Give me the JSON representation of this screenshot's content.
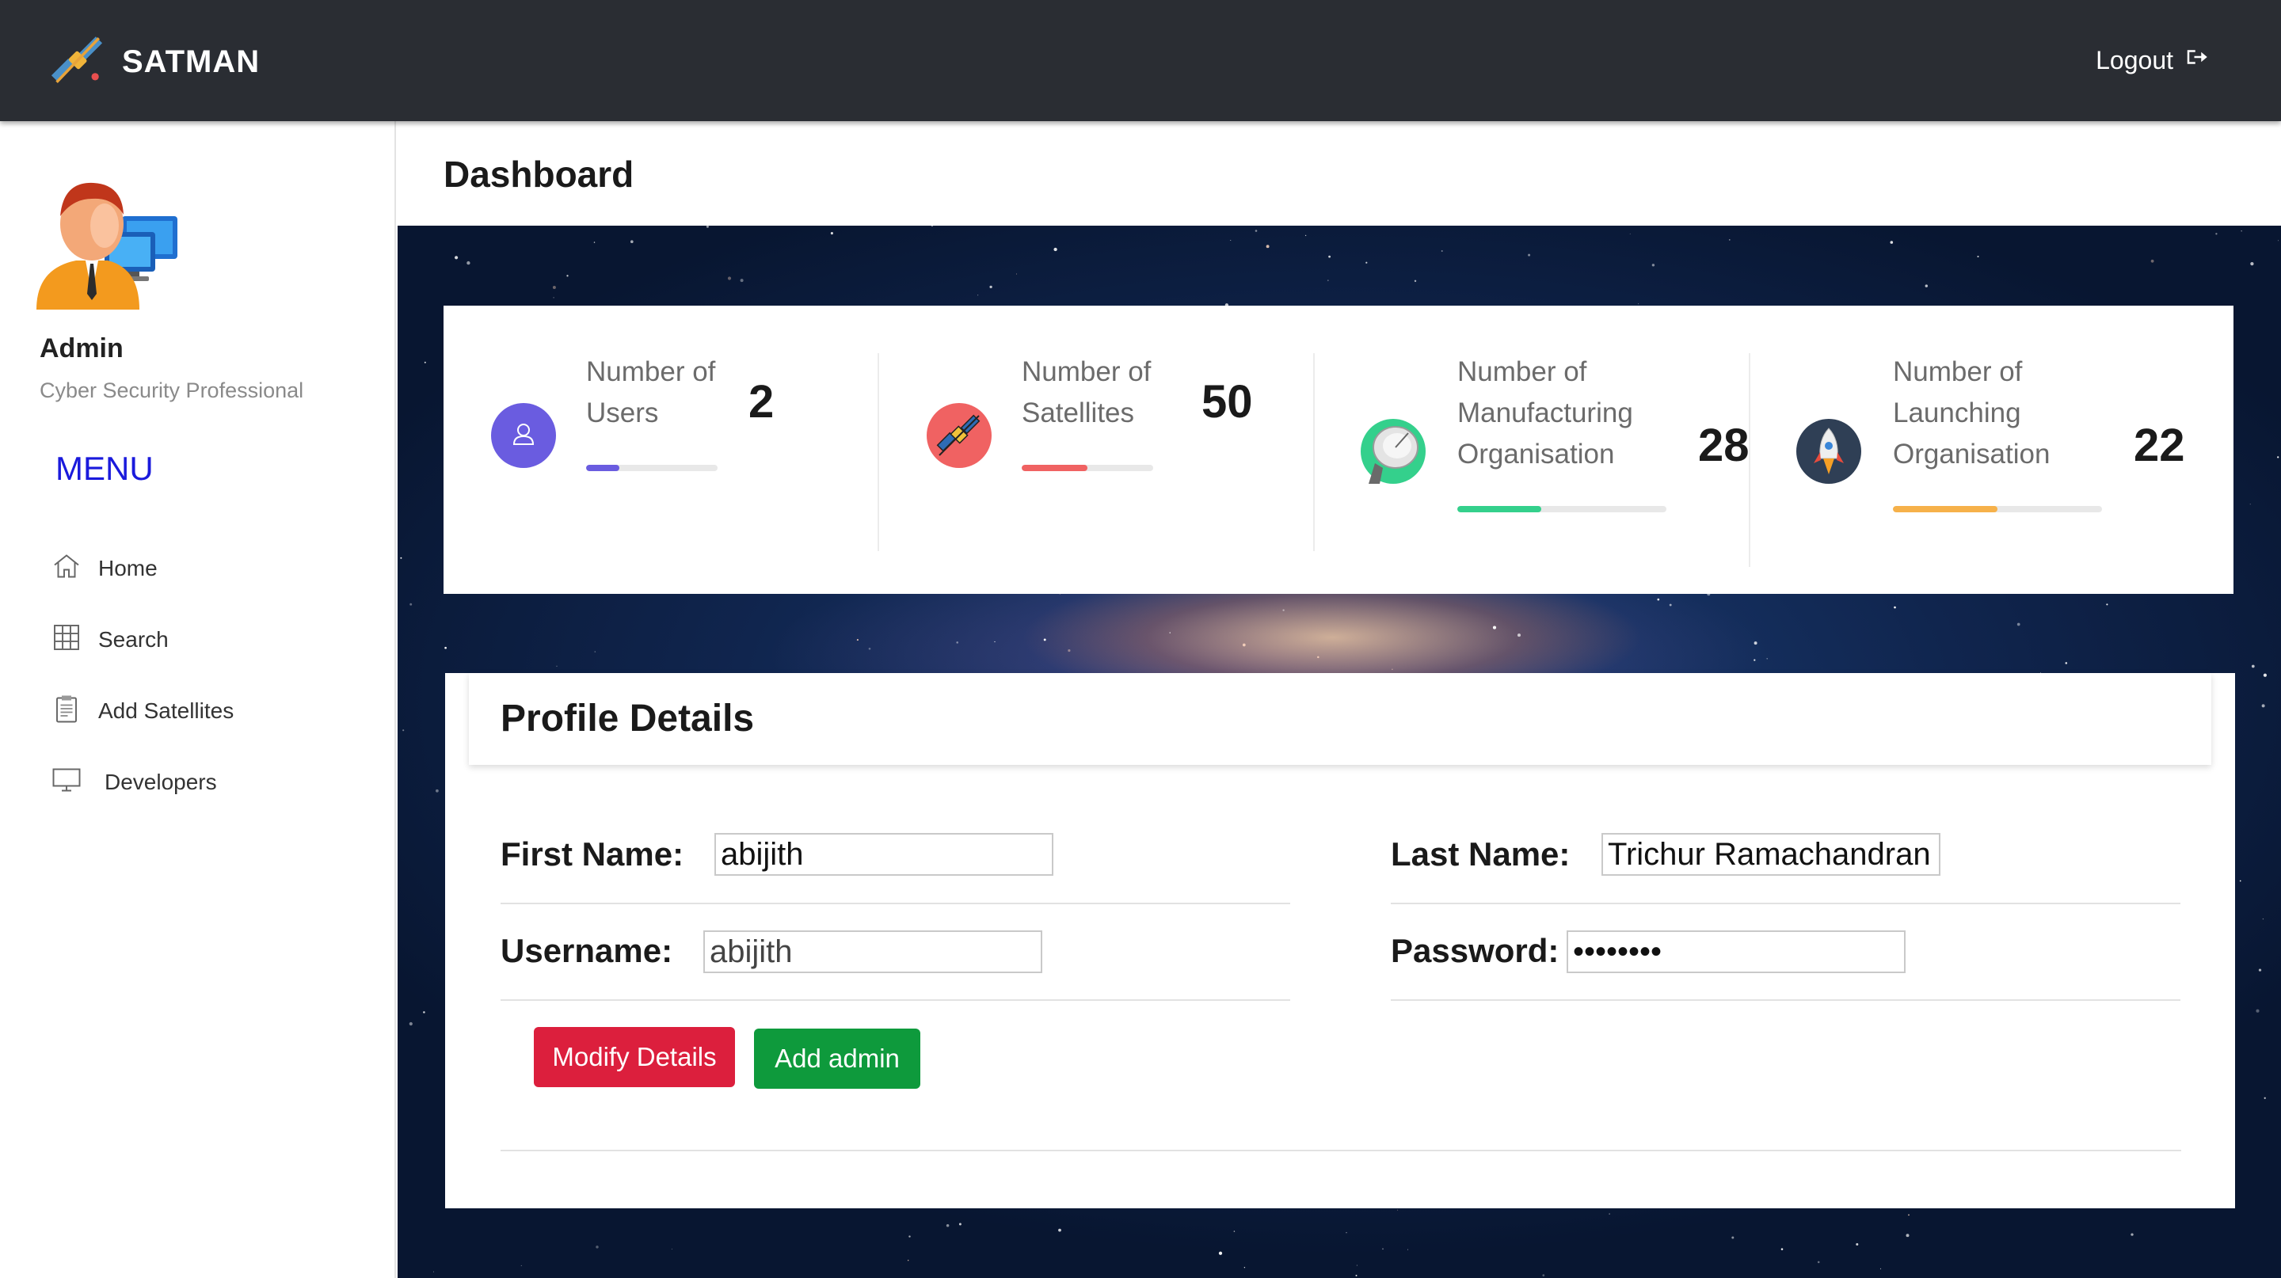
{
  "brand": {
    "name": "SATMAN",
    "icon": "satellite-icon"
  },
  "header": {
    "logout_label": "Logout",
    "logout_icon": "sign-out-icon"
  },
  "sidebar": {
    "user": {
      "name": "Admin",
      "role": "Cyber Security Professional",
      "avatar_icon": "admin-avatar-icon"
    },
    "menu_title": "MENU",
    "items": [
      {
        "label": "Home",
        "icon": "home-icon"
      },
      {
        "label": "Search",
        "icon": "grid-icon"
      },
      {
        "label": "Add Satellites",
        "icon": "clipboard-icon"
      },
      {
        "label": "Developers",
        "icon": "monitor-icon"
      }
    ]
  },
  "main": {
    "title": "Dashboard"
  },
  "stats": [
    {
      "label_line1": "Number of",
      "label_line2": "Users",
      "label_line3": "",
      "value": "2",
      "progress": 0.25,
      "color": "#6a5ce0",
      "icon": "user-icon"
    },
    {
      "label_line1": "Number of",
      "label_line2": "Satellites",
      "label_line3": "",
      "value": "50",
      "progress": 0.5,
      "color": "#f06262",
      "icon": "satellite-icon"
    },
    {
      "label_line1": "Number of",
      "label_line2": "Manufacturing",
      "label_line3": "Organisation",
      "value": "28",
      "progress": 0.4,
      "color": "#34d08c",
      "icon": "satellite-dish-icon"
    },
    {
      "label_line1": "Number of",
      "label_line2": "Launching",
      "label_line3": "Organisation",
      "value": "22",
      "progress": 0.5,
      "color": "#f6b14a",
      "icon": "rocket-icon"
    }
  ],
  "profile": {
    "title": "Profile Details",
    "first_name": {
      "label": "First Name:",
      "value": "abijith"
    },
    "last_name": {
      "label": "Last Name:",
      "value": "Trichur Ramachandran"
    },
    "username": {
      "label": "Username:",
      "value": "abijith"
    },
    "password": {
      "label": "Password:",
      "value": "password"
    },
    "modify_label": "Modify Details",
    "add_admin_label": "Add admin"
  }
}
